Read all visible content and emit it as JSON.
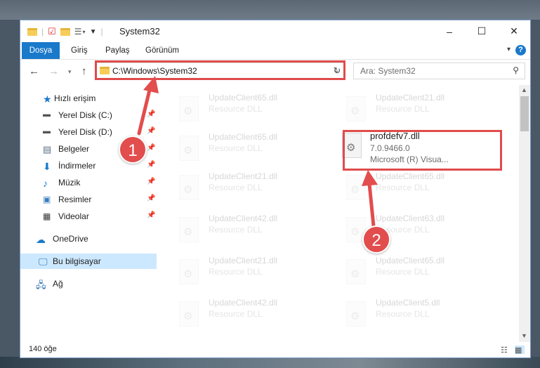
{
  "window": {
    "title": "System32",
    "controls": {
      "minimize": "–",
      "maximize": "☐",
      "close": "✕"
    }
  },
  "ribbon": {
    "tabs": [
      "Dosya",
      "Giriş",
      "Paylaş",
      "Görünüm"
    ],
    "help": "?"
  },
  "address": {
    "path": "C:\\Windows\\System32",
    "search_placeholder": "Ara: System32"
  },
  "sidebar": {
    "quick_access": "Hızlı erişim",
    "items": [
      {
        "label": "Yerel Disk (C:)",
        "icon": "drive-icon",
        "pinned": true
      },
      {
        "label": "Yerel Disk (D:)",
        "icon": "drive-icon",
        "pinned": true
      },
      {
        "label": "Belgeler",
        "icon": "documents-icon",
        "pinned": true
      },
      {
        "label": "İndirmeler",
        "icon": "download-icon",
        "pinned": true
      },
      {
        "label": "Müzik",
        "icon": "music-icon",
        "pinned": true
      },
      {
        "label": "Resimler",
        "icon": "pictures-icon",
        "pinned": true
      },
      {
        "label": "Videolar",
        "icon": "video-icon",
        "pinned": true
      }
    ],
    "onedrive": "OneDrive",
    "this_pc": "Bu bilgisayar",
    "network": "Ağ"
  },
  "files": [
    {
      "name": "UpdateClient65.dll",
      "type": "Resource DLL"
    },
    {
      "name": "UpdateClient21.dll",
      "type": "Resource DLL"
    },
    {
      "name": "UpdateClient65.dll",
      "type": "Resource DLL"
    },
    {
      "name": "profdefv7.dll",
      "version": "7.0.9466.0",
      "desc": "Microsoft (R) Visua..."
    },
    {
      "name": "UpdateClient21.dll",
      "type": "Resource DLL"
    },
    {
      "name": "UpdateClient65.dll",
      "type": "Resource DLL"
    },
    {
      "name": "UpdateClient42.dll",
      "type": "Resource DLL"
    },
    {
      "name": "UpdateClient63.dll",
      "type": "Resource DLL"
    },
    {
      "name": "UpdateClient21.dll",
      "type": "Resource DLL"
    },
    {
      "name": "UpdateClient65.dll",
      "type": "Resource DLL"
    },
    {
      "name": "UpdateClient42.dll",
      "type": "Resource DLL"
    },
    {
      "name": "UpdateClient5.dll",
      "type": "Resource DLL"
    }
  ],
  "status": {
    "count": "140 öğe"
  },
  "annotations": {
    "step1": "1",
    "step2": "2",
    "color": "#e24d4d"
  }
}
